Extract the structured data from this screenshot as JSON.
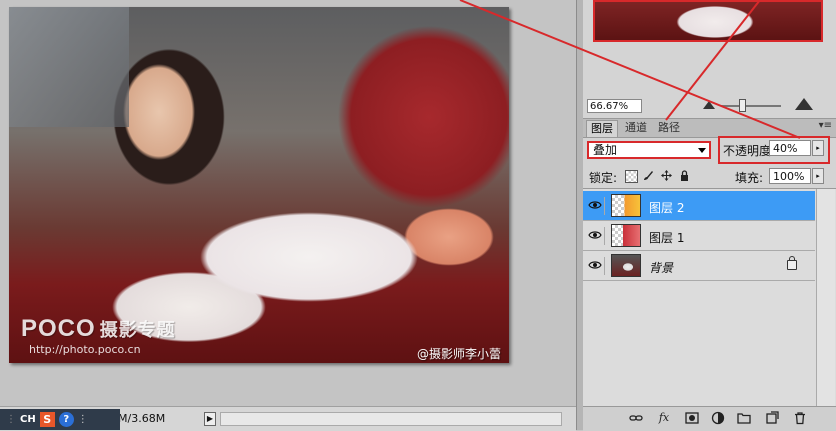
{
  "canvas": {
    "watermark_logo": "POCO",
    "watermark_logo_cn": "摄影专题",
    "watermark_url": "http://photo.poco.cn",
    "watermark_credit": "@摄影师李小蕾"
  },
  "statusbar": {
    "doc_size": "M/3.68M",
    "arrow_glyph": "▶"
  },
  "ime": {
    "dots": "⋮",
    "lang": "CH",
    "sogou": "S",
    "help": "?",
    "more": "⋮"
  },
  "navigator": {
    "zoom": "66.67%"
  },
  "tabs": [
    {
      "label": "图层"
    },
    {
      "label": "通道"
    },
    {
      "label": "路径"
    }
  ],
  "panel_menu_glyph": "▾≡",
  "blend_mode": "叠加",
  "opacity": {
    "label": "不透明度:",
    "value": "40%"
  },
  "lock": {
    "label": "锁定:"
  },
  "fill": {
    "label": "填充:",
    "value": "100%"
  },
  "stepper_glyph": "▸",
  "layers": [
    {
      "name": "图层 2",
      "selected": true
    },
    {
      "name": "图层 1",
      "selected": false
    },
    {
      "name": "背景",
      "selected": false
    }
  ],
  "colors": {
    "accent": "#d8292b",
    "selection": "#3d9bf5"
  }
}
